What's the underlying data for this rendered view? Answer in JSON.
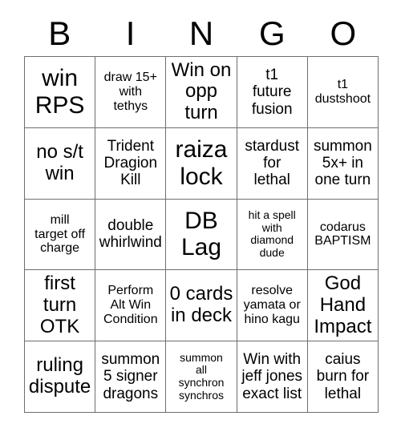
{
  "card": {
    "header_letters": [
      "B",
      "I",
      "N",
      "G",
      "O"
    ],
    "columns": [
      {
        "letter": "B",
        "cells": [
          "win\nRPS",
          "no s/t\nwin",
          "mill\ntarget off\ncharge",
          "first\nturn\nOTK",
          "ruling\ndispute"
        ]
      },
      {
        "letter": "I",
        "cells": [
          "draw 15+\nwith\ntethys",
          "Trident\nDragion\nKill",
          "double\nwhirlwind",
          "Perform\nAlt Win\nCondition",
          "summon\n5 signer\ndragons"
        ]
      },
      {
        "letter": "N",
        "cells": [
          "Win on\nopp\nturn",
          "raiza\nlock",
          "DB\nLag",
          "0 cards\nin deck",
          "summon\nall\nsynchron\nsynchros"
        ]
      },
      {
        "letter": "G",
        "cells": [
          "t1\nfuture\nfusion",
          "stardust\nfor\nlethal",
          "hit a spell\nwith\ndiamond\ndude",
          "resolve\nyamata or\nhino kagu",
          "Win with\njeff jones\nexact list"
        ]
      },
      {
        "letter": "O",
        "cells": [
          "t1\ndustshoot",
          "summon\n5x+ in\none turn",
          "codarus\nBAPTISM",
          "God\nHand\nImpact",
          "caius\nburn for\nlethal"
        ]
      }
    ],
    "rows": [
      [
        "win\nRPS",
        "draw 15+\nwith\ntethys",
        "Win on\nopp\nturn",
        "t1\nfuture\nfusion",
        "t1\ndustshoot"
      ],
      [
        "no s/t\nwin",
        "Trident\nDragion\nKill",
        "raiza\nlock",
        "stardust\nfor\nlethal",
        "summon\n5x+ in\none turn"
      ],
      [
        "mill\ntarget off\ncharge",
        "double\nwhirlwind",
        "DB\nLag",
        "hit a spell\nwith\ndiamond\ndude",
        "codarus\nBAPTISM"
      ],
      [
        "first\nturn\nOTK",
        "Perform\nAlt Win\nCondition",
        "0 cards\nin deck",
        "resolve\nyamata or\nhino kagu",
        "God\nHand\nImpact"
      ],
      [
        "ruling\ndispute",
        "summon\n5 signer\ndragons",
        "summon\nall\nsynchron\nsynchros",
        "Win with\njeff jones\nexact list",
        "caius\nburn for\nlethal"
      ]
    ],
    "colors": {
      "background": "#ffffff",
      "text": "#000000",
      "grid_line": "#6e6e6e"
    }
  }
}
